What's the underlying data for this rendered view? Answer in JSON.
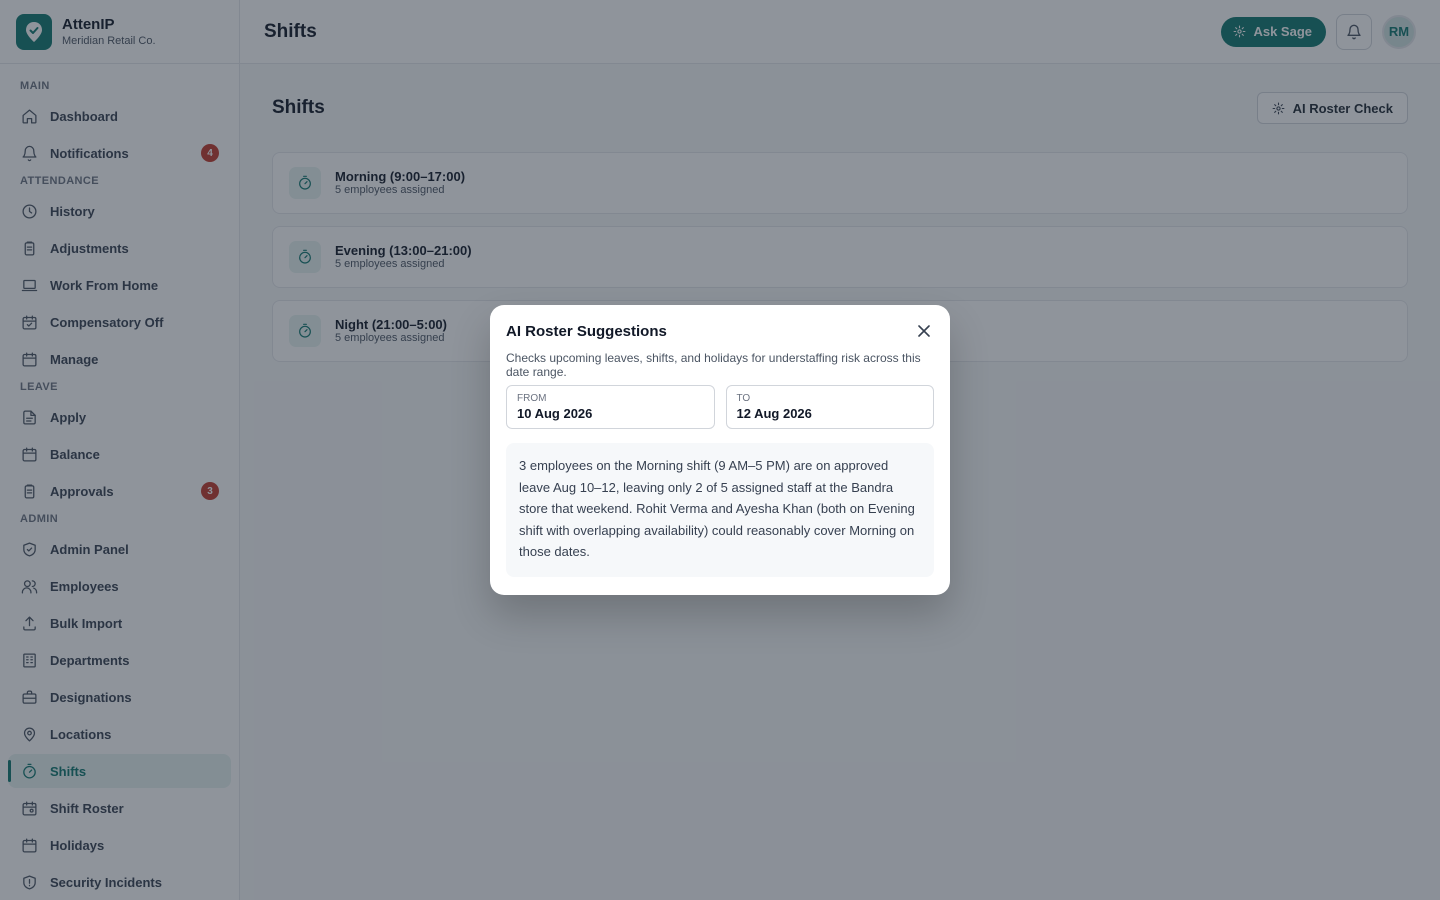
{
  "app": {
    "name": "AttenIP",
    "org": "Meridian Retail Co."
  },
  "sidebar": {
    "sections": [
      {
        "title": "MAIN",
        "items": [
          {
            "label": "Dashboard",
            "icon": "home-icon"
          },
          {
            "label": "Notifications",
            "icon": "bell-icon",
            "badge": "4"
          }
        ]
      },
      {
        "title": "ATTENDANCE",
        "items": [
          {
            "label": "History",
            "icon": "clock-icon"
          },
          {
            "label": "Adjustments",
            "icon": "clipboard-icon"
          },
          {
            "label": "Work From Home",
            "icon": "laptop-icon"
          },
          {
            "label": "Compensatory Off",
            "icon": "calendar-check-icon"
          },
          {
            "label": "Manage",
            "icon": "calendar-icon"
          }
        ]
      },
      {
        "title": "LEAVE",
        "items": [
          {
            "label": "Apply",
            "icon": "document-icon"
          },
          {
            "label": "Balance",
            "icon": "calendar-icon"
          },
          {
            "label": "Approvals",
            "icon": "clipboard-icon",
            "badge": "3"
          }
        ]
      },
      {
        "title": "ADMIN",
        "items": [
          {
            "label": "Admin Panel",
            "icon": "shield-check-icon"
          },
          {
            "label": "Employees",
            "icon": "users-icon"
          },
          {
            "label": "Bulk Import",
            "icon": "upload-icon"
          },
          {
            "label": "Departments",
            "icon": "building-icon"
          },
          {
            "label": "Designations",
            "icon": "briefcase-icon"
          },
          {
            "label": "Locations",
            "icon": "map-pin-icon"
          },
          {
            "label": "Shifts",
            "icon": "timer-icon",
            "active": true
          },
          {
            "label": "Shift Roster",
            "icon": "calendar-user-icon"
          },
          {
            "label": "Holidays",
            "icon": "calendar-icon"
          },
          {
            "label": "Security Incidents",
            "icon": "shield-alert-icon"
          }
        ]
      }
    ]
  },
  "topbar": {
    "title": "Shifts",
    "ask_label": "Ask Sage",
    "avatar_initials": "RM"
  },
  "main": {
    "title": "Shifts",
    "roster_check_label": "AI Roster Check",
    "shifts": [
      {
        "name": "Morning (9:00–17:00)",
        "count": "5 employees assigned"
      },
      {
        "name": "Evening (13:00–21:00)",
        "count": "5 employees assigned"
      },
      {
        "name": "Night (21:00–5:00)",
        "count": "5 employees assigned"
      }
    ]
  },
  "modal": {
    "title": "AI Roster Suggestions",
    "description": "Checks upcoming leaves, shifts, and holidays for understaffing risk across this date range.",
    "from_label": "FROM",
    "from_value": "10 Aug 2026",
    "to_label": "TO",
    "to_value": "12 Aug 2026",
    "result": "3 employees on the Morning shift (9 AM–5 PM) are on approved leave Aug 10–12, leaving only 2 of 5 assigned staff at the Bandra store that weekend. Rohit Verma and Ayesha Khan (both on Evening shift with overlapping availability) could reasonably cover Morning on those dates."
  },
  "colors": {
    "accent": "#0f766e",
    "badge": "#c0392b",
    "overlay": "rgba(31,41,55,0.5)"
  }
}
